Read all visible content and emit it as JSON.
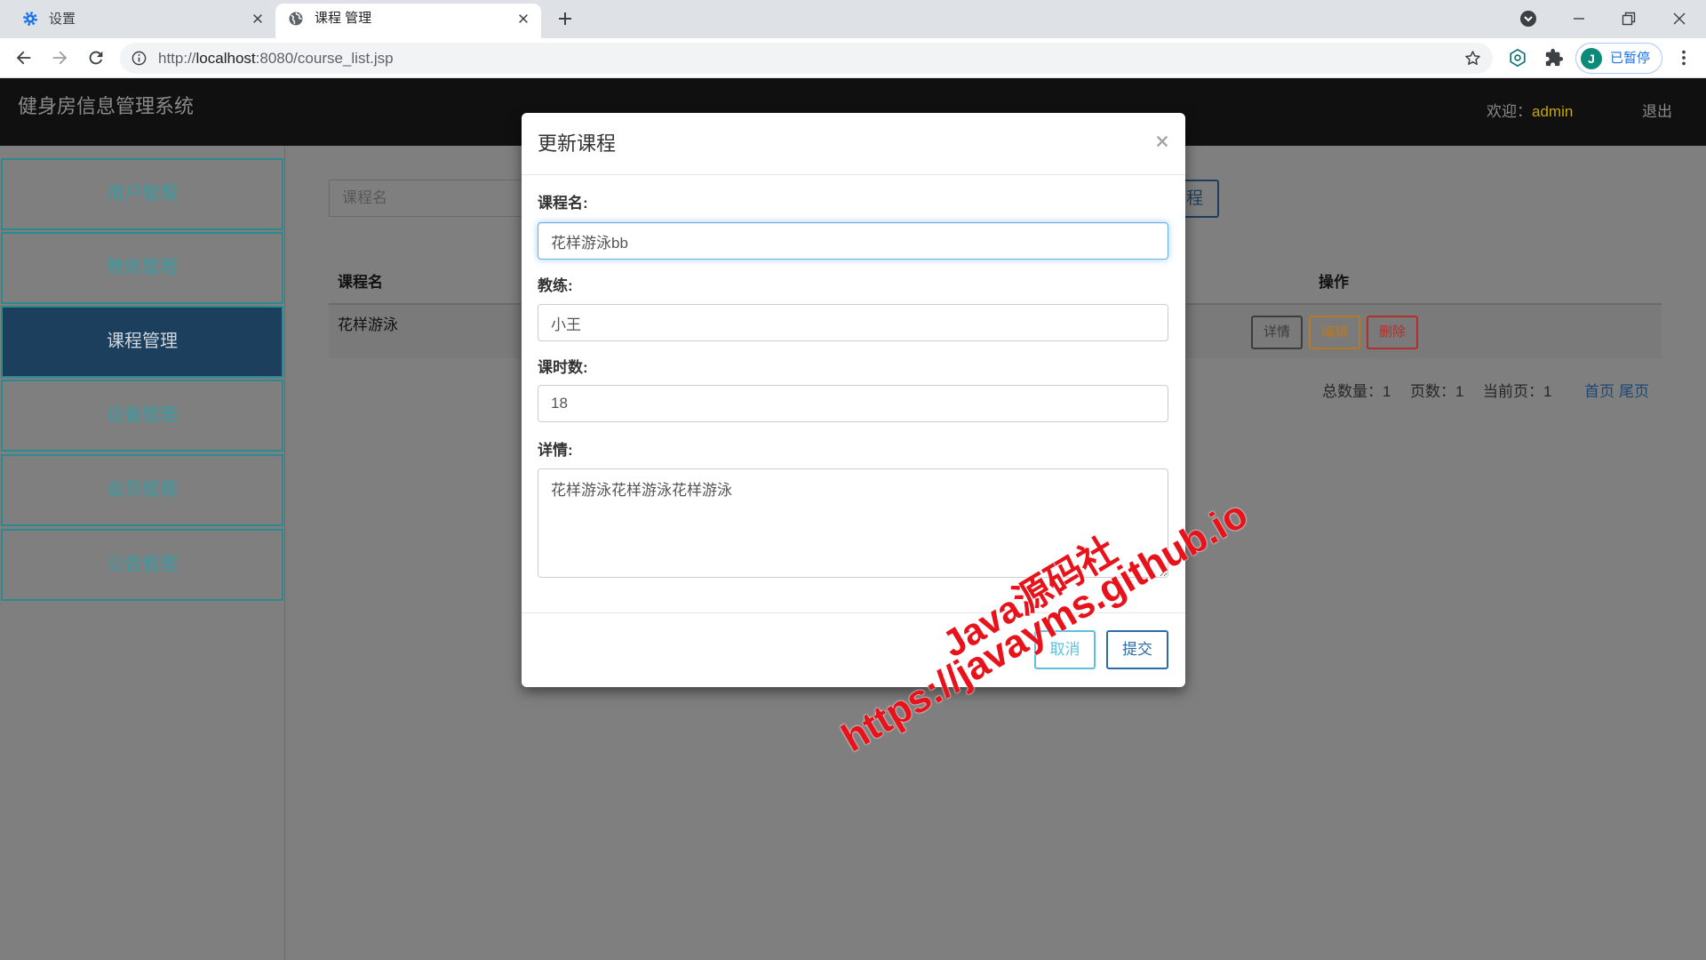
{
  "browser": {
    "tabs": [
      {
        "title": "设置",
        "icon": "gear-icon",
        "active": false
      },
      {
        "title": "课程 管理",
        "icon": "globe-icon",
        "active": true
      }
    ],
    "url": {
      "scheme": "http://",
      "host": "localhost",
      "path": ":8080/course_list.jsp"
    },
    "profile": {
      "initial": "J",
      "status": "已暂停"
    }
  },
  "header": {
    "title": "健身房信息管理系统",
    "welcome": "欢迎：",
    "user": "admin",
    "logout": "退出"
  },
  "sidebar": {
    "items": [
      {
        "label": "用户管理",
        "active": false
      },
      {
        "label": "教练管理",
        "active": false
      },
      {
        "label": "课程管理",
        "active": true
      },
      {
        "label": "设备管理",
        "active": false
      },
      {
        "label": "会员管理",
        "active": false
      },
      {
        "label": "公告管理",
        "active": false
      }
    ]
  },
  "toolbar": {
    "search_placeholder": "课程名",
    "add_button_visible_text": "程"
  },
  "table": {
    "columns": [
      "课程名",
      "操作"
    ],
    "rows": [
      {
        "name": "花样游泳",
        "actions": [
          "详情",
          "编辑",
          "删除"
        ]
      }
    ]
  },
  "pagination": {
    "total": "总数量：1",
    "pages": "页数：1",
    "current": "当前页：1",
    "first": "首页",
    "last": "尾页"
  },
  "modal": {
    "title": "更新课程",
    "fields": [
      {
        "label": "课程名:",
        "value": "花样游泳bb"
      },
      {
        "label": "教练:",
        "value": "小王"
      },
      {
        "label": "课时数:",
        "value": "18"
      },
      {
        "label": "详情:",
        "value": "花样游泳花样游泳花样游泳"
      }
    ],
    "cancel": "取消",
    "submit": "提交"
  },
  "watermark": {
    "line1": "Java源码社",
    "line2": "https://javayms.github.io"
  },
  "colors": {
    "header_bg": "#101010",
    "admin_highlight": "#c6a800",
    "sidebar_accent": "#2a8a90",
    "sidebar_active": "#1b3f5d",
    "primary_button": "#2e6da4",
    "info_button": "#5bc0de",
    "warning": "#b5792a",
    "danger": "#b0302c",
    "profile_accent": "#1a73e8",
    "watermark": "#e8121b"
  }
}
